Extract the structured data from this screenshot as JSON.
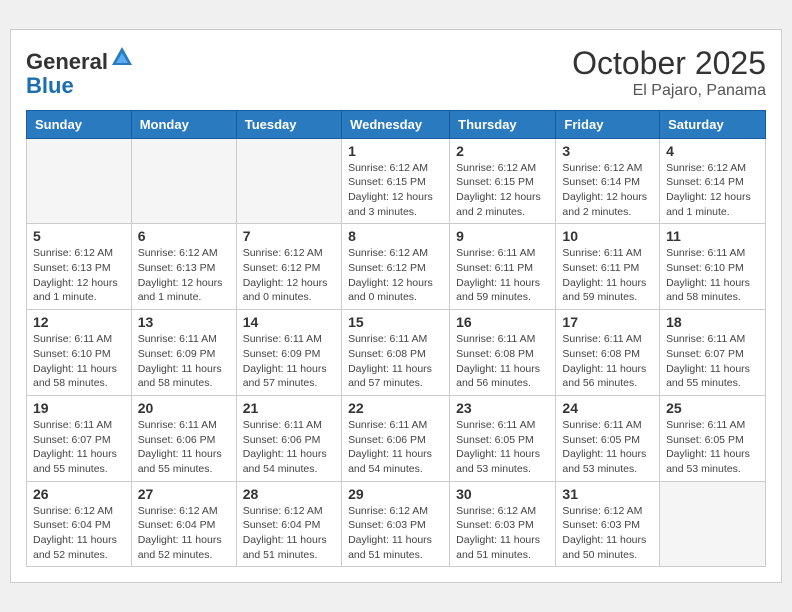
{
  "header": {
    "logo_general": "General",
    "logo_blue": "Blue",
    "month": "October 2025",
    "location": "El Pajaro, Panama"
  },
  "days_of_week": [
    "Sunday",
    "Monday",
    "Tuesday",
    "Wednesday",
    "Thursday",
    "Friday",
    "Saturday"
  ],
  "weeks": [
    [
      {
        "day": "",
        "info": ""
      },
      {
        "day": "",
        "info": ""
      },
      {
        "day": "",
        "info": ""
      },
      {
        "day": "1",
        "info": "Sunrise: 6:12 AM\nSunset: 6:15 PM\nDaylight: 12 hours and 3 minutes."
      },
      {
        "day": "2",
        "info": "Sunrise: 6:12 AM\nSunset: 6:15 PM\nDaylight: 12 hours and 2 minutes."
      },
      {
        "day": "3",
        "info": "Sunrise: 6:12 AM\nSunset: 6:14 PM\nDaylight: 12 hours and 2 minutes."
      },
      {
        "day": "4",
        "info": "Sunrise: 6:12 AM\nSunset: 6:14 PM\nDaylight: 12 hours and 1 minute."
      }
    ],
    [
      {
        "day": "5",
        "info": "Sunrise: 6:12 AM\nSunset: 6:13 PM\nDaylight: 12 hours and 1 minute."
      },
      {
        "day": "6",
        "info": "Sunrise: 6:12 AM\nSunset: 6:13 PM\nDaylight: 12 hours and 1 minute."
      },
      {
        "day": "7",
        "info": "Sunrise: 6:12 AM\nSunset: 6:12 PM\nDaylight: 12 hours and 0 minutes."
      },
      {
        "day": "8",
        "info": "Sunrise: 6:12 AM\nSunset: 6:12 PM\nDaylight: 12 hours and 0 minutes."
      },
      {
        "day": "9",
        "info": "Sunrise: 6:11 AM\nSunset: 6:11 PM\nDaylight: 11 hours and 59 minutes."
      },
      {
        "day": "10",
        "info": "Sunrise: 6:11 AM\nSunset: 6:11 PM\nDaylight: 11 hours and 59 minutes."
      },
      {
        "day": "11",
        "info": "Sunrise: 6:11 AM\nSunset: 6:10 PM\nDaylight: 11 hours and 58 minutes."
      }
    ],
    [
      {
        "day": "12",
        "info": "Sunrise: 6:11 AM\nSunset: 6:10 PM\nDaylight: 11 hours and 58 minutes."
      },
      {
        "day": "13",
        "info": "Sunrise: 6:11 AM\nSunset: 6:09 PM\nDaylight: 11 hours and 58 minutes."
      },
      {
        "day": "14",
        "info": "Sunrise: 6:11 AM\nSunset: 6:09 PM\nDaylight: 11 hours and 57 minutes."
      },
      {
        "day": "15",
        "info": "Sunrise: 6:11 AM\nSunset: 6:08 PM\nDaylight: 11 hours and 57 minutes."
      },
      {
        "day": "16",
        "info": "Sunrise: 6:11 AM\nSunset: 6:08 PM\nDaylight: 11 hours and 56 minutes."
      },
      {
        "day": "17",
        "info": "Sunrise: 6:11 AM\nSunset: 6:08 PM\nDaylight: 11 hours and 56 minutes."
      },
      {
        "day": "18",
        "info": "Sunrise: 6:11 AM\nSunset: 6:07 PM\nDaylight: 11 hours and 55 minutes."
      }
    ],
    [
      {
        "day": "19",
        "info": "Sunrise: 6:11 AM\nSunset: 6:07 PM\nDaylight: 11 hours and 55 minutes."
      },
      {
        "day": "20",
        "info": "Sunrise: 6:11 AM\nSunset: 6:06 PM\nDaylight: 11 hours and 55 minutes."
      },
      {
        "day": "21",
        "info": "Sunrise: 6:11 AM\nSunset: 6:06 PM\nDaylight: 11 hours and 54 minutes."
      },
      {
        "day": "22",
        "info": "Sunrise: 6:11 AM\nSunset: 6:06 PM\nDaylight: 11 hours and 54 minutes."
      },
      {
        "day": "23",
        "info": "Sunrise: 6:11 AM\nSunset: 6:05 PM\nDaylight: 11 hours and 53 minutes."
      },
      {
        "day": "24",
        "info": "Sunrise: 6:11 AM\nSunset: 6:05 PM\nDaylight: 11 hours and 53 minutes."
      },
      {
        "day": "25",
        "info": "Sunrise: 6:11 AM\nSunset: 6:05 PM\nDaylight: 11 hours and 53 minutes."
      }
    ],
    [
      {
        "day": "26",
        "info": "Sunrise: 6:12 AM\nSunset: 6:04 PM\nDaylight: 11 hours and 52 minutes."
      },
      {
        "day": "27",
        "info": "Sunrise: 6:12 AM\nSunset: 6:04 PM\nDaylight: 11 hours and 52 minutes."
      },
      {
        "day": "28",
        "info": "Sunrise: 6:12 AM\nSunset: 6:04 PM\nDaylight: 11 hours and 51 minutes."
      },
      {
        "day": "29",
        "info": "Sunrise: 6:12 AM\nSunset: 6:03 PM\nDaylight: 11 hours and 51 minutes."
      },
      {
        "day": "30",
        "info": "Sunrise: 6:12 AM\nSunset: 6:03 PM\nDaylight: 11 hours and 51 minutes."
      },
      {
        "day": "31",
        "info": "Sunrise: 6:12 AM\nSunset: 6:03 PM\nDaylight: 11 hours and 50 minutes."
      },
      {
        "day": "",
        "info": ""
      }
    ]
  ]
}
